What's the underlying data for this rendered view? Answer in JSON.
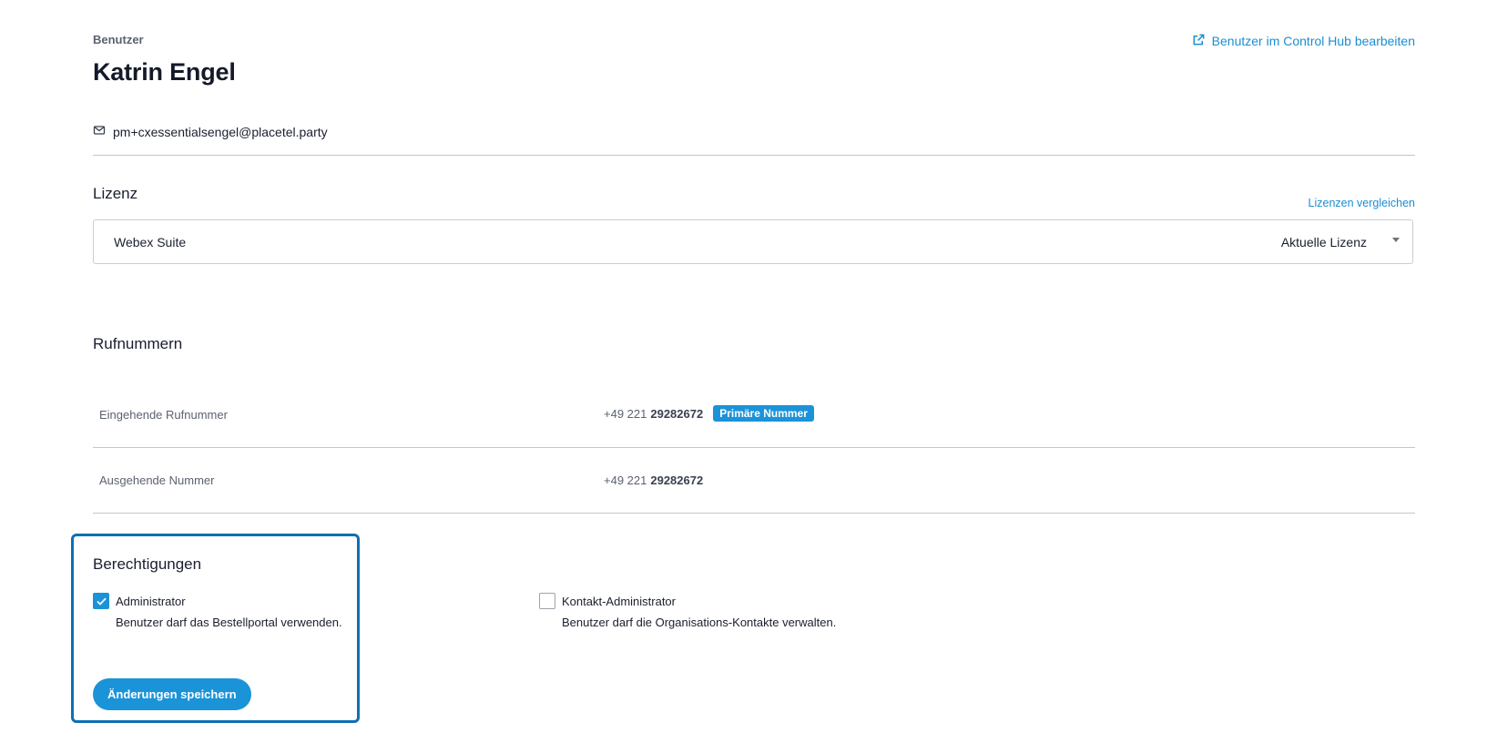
{
  "header": {
    "breadcrumb": "Benutzer",
    "title": "Katrin Engel",
    "edit_link_label": "Benutzer im Control Hub bearbeiten",
    "edit_link_icon": "external-link-icon",
    "email": "pm+cxessentialsengel@placetel.party",
    "email_icon": "mail-icon"
  },
  "license": {
    "section_title": "Lizenz",
    "compare_link_label": "Lizenzen vergleichen",
    "selected_name": "Webex Suite",
    "selected_status": "Aktuelle Lizenz"
  },
  "numbers": {
    "section_title": "Rufnummern",
    "rows": [
      {
        "label": "Eingehende Rufnummer",
        "prefix": "+49 221",
        "number": "29282672",
        "badge": "Primäre Nummer"
      },
      {
        "label": "Ausgehende Nummer",
        "prefix": "+49 221",
        "number": "29282672"
      }
    ]
  },
  "permissions": {
    "section_title": "Berechtigungen",
    "items": [
      {
        "label": "Administrator",
        "description": "Benutzer darf das Bestellportal verwenden.",
        "checked": true
      },
      {
        "label": "Kontakt-Administrator",
        "description": "Benutzer darf die Organisations-Kontakte verwalten.",
        "checked": false
      }
    ],
    "save_label": "Änderungen speichern"
  },
  "colors": {
    "accent": "#1b93d8",
    "link": "#1b8ed1",
    "focus_border": "#0f6fb4"
  }
}
